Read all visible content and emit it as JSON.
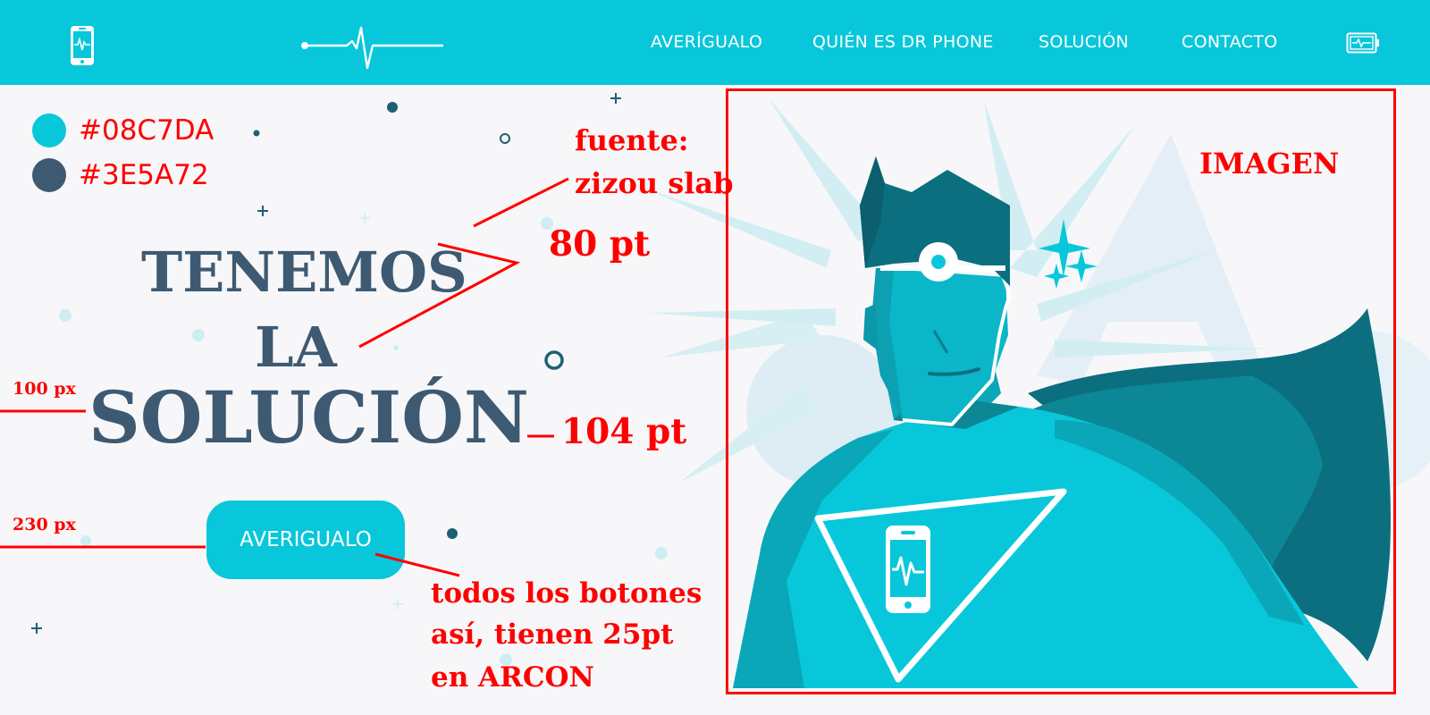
{
  "nav": {
    "items": [
      "AVERÍGUALO",
      "QUIÉN ES DR PHONE",
      "SOLUCIÓN",
      "CONTACTO"
    ]
  },
  "palette": {
    "primary": "#08C7DA",
    "secondary": "#3E5A72"
  },
  "hero": {
    "line1": "TENEMOS",
    "line2": "LA",
    "line3": "SOLUCIÓN",
    "cta_label": "AVERIGUALO"
  },
  "annotations": {
    "font_note_1": "fuente:",
    "font_note_2": "zizou slab",
    "size_80": "80 pt",
    "size_104": "104 pt",
    "margin_100": "100 px",
    "margin_230": "230 px",
    "buttons_note_1": "todos los botones",
    "buttons_note_2": "así, tienen 25pt",
    "buttons_note_3": "en ARCON",
    "image_label": "IMAGEN"
  },
  "colors": {
    "annotation_red": "#ff0000",
    "background": "#f7f7f9"
  },
  "icons": [
    "phone-logo-icon",
    "heartbeat-logo-icon",
    "battery-phone-icon",
    "phone-chest-icon"
  ]
}
